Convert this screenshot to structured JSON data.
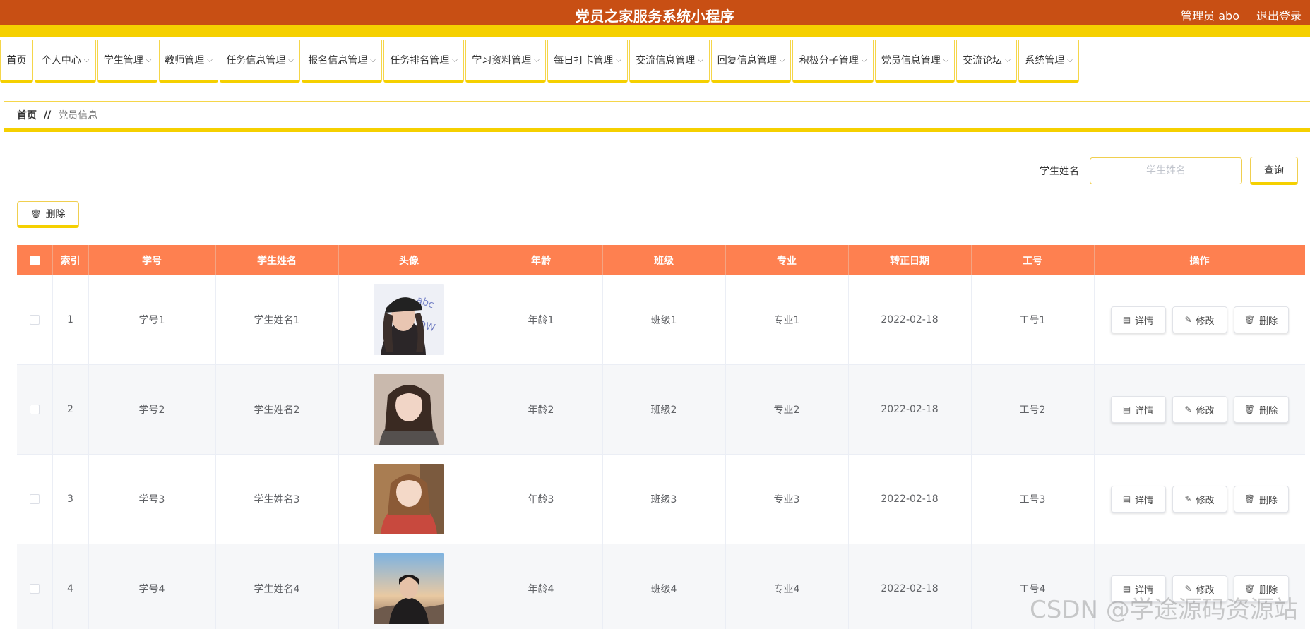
{
  "header": {
    "title": "党员之家服务系统小程序",
    "user": "管理员 abo",
    "logout": "退出登录",
    "bar_color": "#c84f14",
    "band_color": "#f5d000"
  },
  "nav": {
    "items": [
      {
        "label": "首页",
        "has_dropdown": false
      },
      {
        "label": "个人中心",
        "has_dropdown": true
      },
      {
        "label": "学生管理",
        "has_dropdown": true
      },
      {
        "label": "教师管理",
        "has_dropdown": true
      },
      {
        "label": "任务信息管理",
        "has_dropdown": true
      },
      {
        "label": "报名信息管理",
        "has_dropdown": true
      },
      {
        "label": "任务排名管理",
        "has_dropdown": true
      },
      {
        "label": "学习资料管理",
        "has_dropdown": true
      },
      {
        "label": "每日打卡管理",
        "has_dropdown": true
      },
      {
        "label": "交流信息管理",
        "has_dropdown": true
      },
      {
        "label": "回复信息管理",
        "has_dropdown": true
      },
      {
        "label": "积极分子管理",
        "has_dropdown": true
      },
      {
        "label": "党员信息管理",
        "has_dropdown": true
      },
      {
        "label": "交流论坛",
        "has_dropdown": true
      },
      {
        "label": "系统管理",
        "has_dropdown": true
      }
    ]
  },
  "breadcrumb": {
    "home": "首页",
    "separator": "//",
    "current": "党员信息"
  },
  "search": {
    "label": "学生姓名",
    "placeholder": "学生姓名",
    "value": "",
    "button": "查询"
  },
  "toolbar": {
    "delete_label": "删除"
  },
  "table": {
    "header_color": "#fe8050",
    "columns": [
      "索引",
      "学号",
      "学生姓名",
      "头像",
      "年龄",
      "班级",
      "专业",
      "转正日期",
      "工号",
      "操作"
    ],
    "actions": {
      "detail": "详情",
      "edit": "修改",
      "delete": "删除"
    },
    "rows": [
      {
        "index": "1",
        "student_no": "学号1",
        "name": "学生姓名1",
        "age": "年龄1",
        "class": "班级1",
        "major": "专业1",
        "date": "2022-02-18",
        "job_no": "工号1"
      },
      {
        "index": "2",
        "student_no": "学号2",
        "name": "学生姓名2",
        "age": "年龄2",
        "class": "班级2",
        "major": "专业2",
        "date": "2022-02-18",
        "job_no": "工号2"
      },
      {
        "index": "3",
        "student_no": "学号3",
        "name": "学生姓名3",
        "age": "年龄3",
        "class": "班级3",
        "major": "专业3",
        "date": "2022-02-18",
        "job_no": "工号3"
      },
      {
        "index": "4",
        "student_no": "学号4",
        "name": "学生姓名4",
        "age": "年龄4",
        "class": "班级4",
        "major": "专业4",
        "date": "2022-02-18",
        "job_no": "工号4"
      }
    ]
  },
  "watermark": "CSDN @学途源码资源站"
}
